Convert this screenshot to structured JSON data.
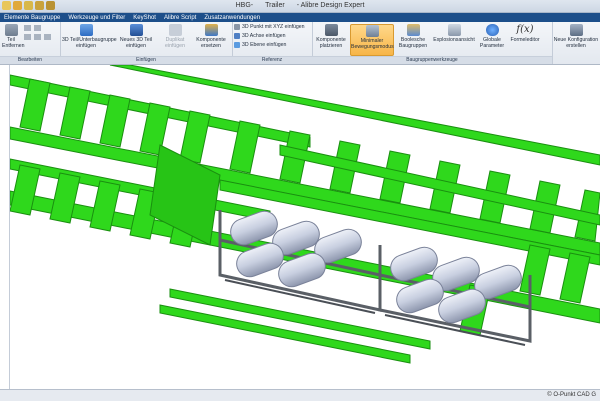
{
  "window": {
    "title_parts": [
      "HBG-",
      "Trailer",
      "- Alibre Design Expert"
    ],
    "quick_access_icons": [
      "new-icon",
      "open-icon",
      "save-icon",
      "undo-icon",
      "redo-icon"
    ]
  },
  "menu": [
    "Elemente Baugruppe",
    "Werkzeuge und Filter",
    "KeyShot",
    "Alibre Script",
    "Zusatzanwendungen"
  ],
  "ribbon": {
    "groups": [
      {
        "label": "Bearbeiten"
      },
      {
        "label": "Einfügen"
      },
      {
        "label": "Referenz"
      },
      {
        "label": "Baugruppenwerkzeuge"
      }
    ],
    "buttons": {
      "teil_loeschen": "Teil\nEntfernen",
      "einfuegen_teil": "3D Teil/Unterbaugruppe\neinfügen",
      "neues_teil": "Neues 3D Teil\neinfügen",
      "duplikat": "Duplikat\neinfügen",
      "komponente_ersetzen": "Komponente\nersetzen",
      "punkt": "3D Punkt mit XYZ einfügen",
      "achse": "3D Achse einfügen",
      "ebene": "3D Ebene einfügen",
      "komponente_platzieren": "Komponente\nplatzieren",
      "minimaler_modus": "Minimaler\nBewegungsmodus",
      "boolesche": "Boolesche\nBaugruppen",
      "explosion": "Explosionsansicht",
      "globale_parameter": "Globale\nParameter",
      "formeleditor": "Formeleditor",
      "neue_konfiguration": "Neue Konfiguration\nerstellen"
    }
  },
  "status": {
    "copyright": "© O-Punkt CAD G"
  },
  "colors": {
    "frame_green": "#2fd81c",
    "frame_dark": "#1a8f10",
    "menubar": "#1d4f8a",
    "tank": "#c8cfe0",
    "bracket": "#5a5f66"
  }
}
